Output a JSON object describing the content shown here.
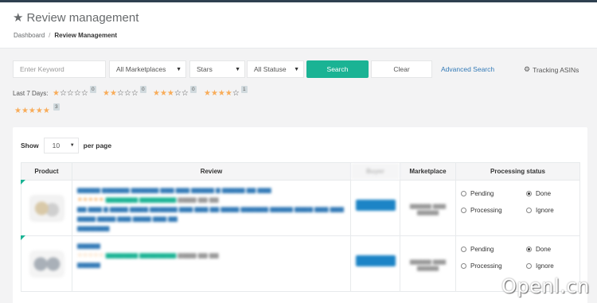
{
  "header": {
    "title": "Review management",
    "breadcrumb": {
      "home": "Dashboard",
      "separator": "/",
      "current": "Review Management"
    }
  },
  "filters": {
    "keyword_placeholder": "Enter Keyword",
    "marketplace": "All Marketplaces",
    "stars": "Stars",
    "status": "All Statuse",
    "search_label": "Search",
    "clear_label": "Clear",
    "advanced_search_label": "Advanced Search",
    "tracking_label": "Tracking ASINs"
  },
  "last7": {
    "label": "Last 7 Days:",
    "groups": [
      {
        "stars": 1,
        "count": "0"
      },
      {
        "stars": 2,
        "count": "0"
      },
      {
        "stars": 3,
        "count": "0"
      },
      {
        "stars": 4,
        "count": "1"
      },
      {
        "stars": 5,
        "count": "3"
      }
    ]
  },
  "table": {
    "show_label": "Show",
    "per_page_value": "10",
    "per_page_label": "per page",
    "columns": [
      "Product",
      "Review",
      "Buyer",
      "Marketplace",
      "Processing status"
    ],
    "status_options": [
      "Pending",
      "Done",
      "Processing",
      "Ignore"
    ],
    "rows": [
      {
        "selected_status": "Done"
      },
      {
        "selected_status": "Done"
      }
    ]
  },
  "watermark": "Openl.cn",
  "colors": {
    "accent": "#1ab394",
    "star": "#f8ac59",
    "link": "#337ab7",
    "buyer_button": "#1c84c6"
  }
}
